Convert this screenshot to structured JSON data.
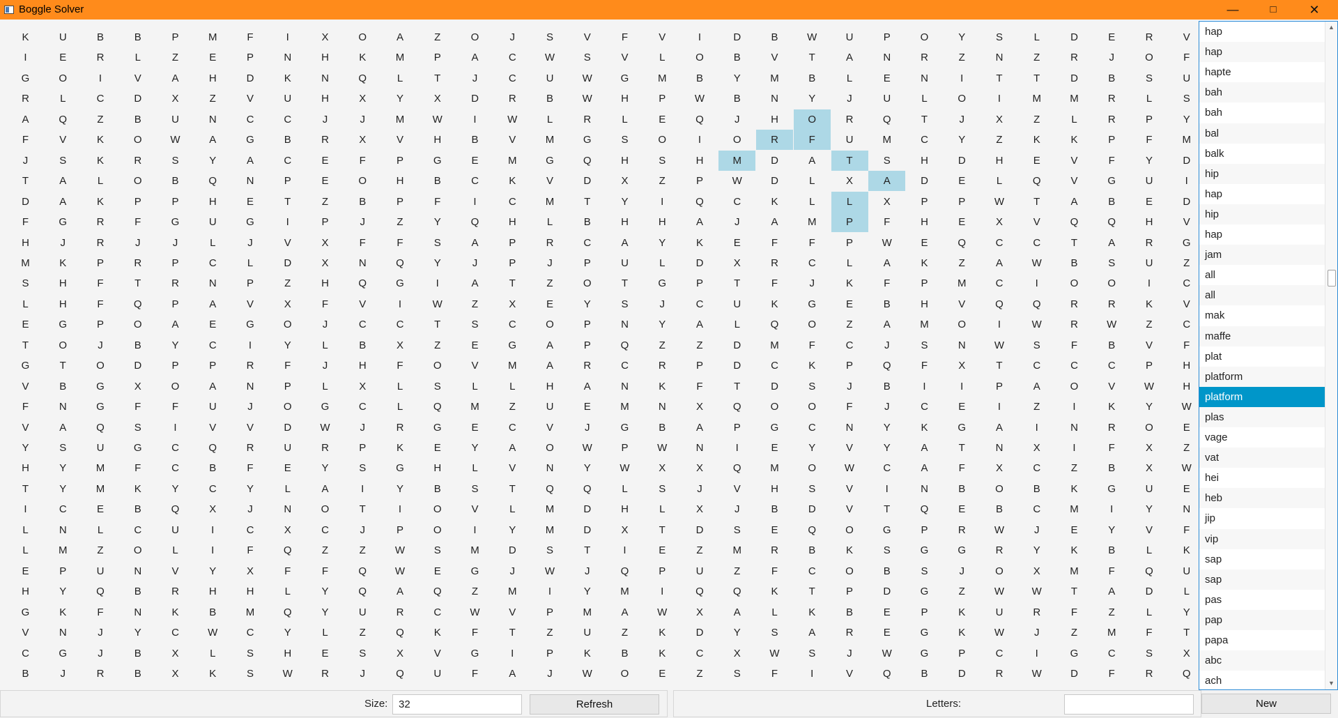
{
  "window": {
    "title": "Boggle Solver",
    "minimize_label": "—",
    "maximize_label": "□",
    "close_label": "✕"
  },
  "grid": {
    "rows": [
      "KUBBPMFIXOAZOJSVFVIDBWUPOYSLDERV",
      "IERLZEPNHKMPACWSVLOBVTANRZNZRJOF",
      "GOIVAHDKNQLTJCUWGMBYMBLENITTDBSU",
      "RLCDXZVUHXYXDRBWHPWBNYJULOIMMRLS",
      "AQZBUNCCJJMWIWLRLEQJHORQTJXZLRPY",
      "FVKOWAGBRXVHBVMGSOIORFUMCYZKKPFM",
      "JSKRSYACEFPGEMGQHSHMDATSHDHEVFYD",
      "TALOBQNPEOHBCKVDXZPWDLXADELQVGUI",
      "DAKPPHETZBPFICMTYIQCKLLXPPWTABED",
      "FGRFGUGIPJZYQHLBHHAJAMPFHEXVQQHV",
      "HJRJJLJVXFFSAPRCAYKEFFPWEQCCTARG",
      "MKPRPCLDXNQYJPJPULDXRCLAKZAWBSUZ",
      "SHFTRNPZHQGIATZOTGPTFJKFPMCIOOIC",
      "LHFQPAVXFVIWZXEYSJCUKGEBHVQQRRKV",
      "EGPOAEGOJCCTSCOPNYALQOZAMOIWRWZC",
      "TOJBYCIYLBXZEGAPQZZDMFCJSNWSFBVF",
      "GTODPPRFJHFOVMARCRPDCKPQFXTCCCPH",
      "VBGXOANPLXLSLLHANKFTDSJBIIPAOVWH",
      "FNGFFUJOGCLQMZUEMNXQOOFJCEIZIKYW",
      "VAQSIVVDWJRGECVJGBAPGCNYKGAINROE",
      "YSUGCQRURPKEYAOWPWNIEYVYATNXIFXZ",
      "HYMFCBFEYSGHLVNYWXXQMOWCAFXCZBXW",
      "TYMKYCYLAIYBSTQQLSJVHSVINBOBKGUE",
      "ICEBQXJNOTIOVLMDHLXJBDVTQEBCMIYN",
      "LNLCUICXCJPOIYMDXTDSEQOGPRWJEYVF",
      "LMZOLIFQZZWSMDSTIEZMRBKSGGRYKBLK",
      "EPUNVYXFFQWEGJWJQPUZFCOBSJOXMFQU",
      "HYQBRHHLYQAQZMIYMIQQKTPDGZWWTADL",
      "GKFNKBMQYURCWVPMAWXALKBEPKURFZLY",
      "VNJYCWCYLZQKFTZUZKDYSAREGKWJZMFT",
      "CGJBXLSHESXVGIPKBKCXWSJWGPCIGCSX",
      "BJRBXKSWRJQUFAJWOEZSFIVQBDRWDFRQ"
    ],
    "highlighted": [
      [
        4,
        21
      ],
      [
        5,
        20
      ],
      [
        5,
        21
      ],
      [
        6,
        19
      ],
      [
        6,
        22
      ],
      [
        7,
        23
      ],
      [
        8,
        22
      ],
      [
        9,
        22
      ]
    ]
  },
  "word_list": {
    "words": [
      "hap",
      "hap",
      "hapte",
      "bah",
      "bah",
      "bal",
      "balk",
      "hip",
      "hap",
      "hip",
      "hap",
      "jam",
      "all",
      "all",
      "mak",
      "maffe",
      "plat",
      "platform",
      "platform",
      "plas",
      "vage",
      "vat",
      "hei",
      "heb",
      "jip",
      "vip",
      "sap",
      "sap",
      "pas",
      "pap",
      "papa",
      "abc",
      "ach"
    ],
    "selected_index": 18,
    "scroll_up": "▲",
    "scroll_down": "▼"
  },
  "controls": {
    "size_label": "Size:",
    "size_value": "32",
    "refresh_label": "Refresh",
    "letters_label": "Letters:",
    "letters_value": "",
    "new_label": "New"
  }
}
